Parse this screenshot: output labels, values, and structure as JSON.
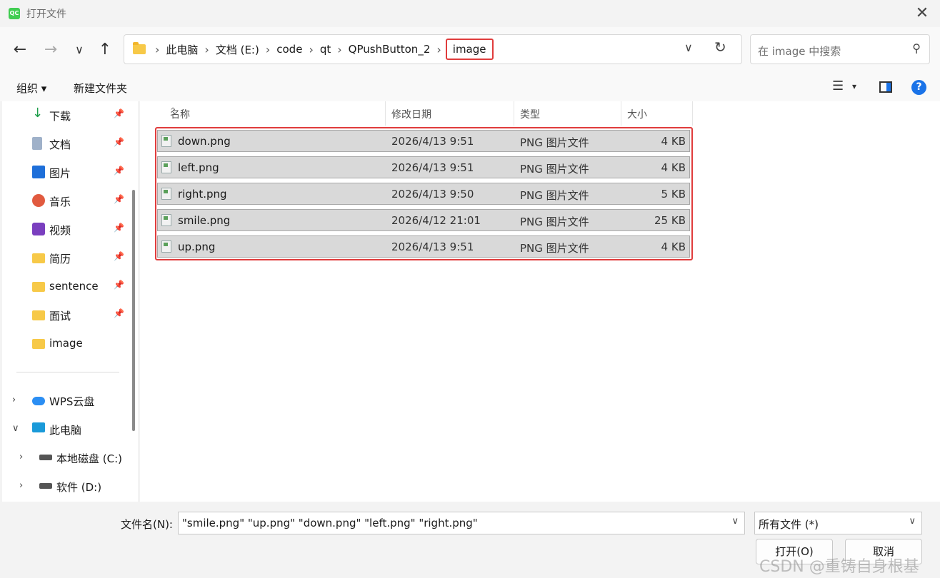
{
  "window": {
    "title": "打开文件",
    "app_icon": "QC"
  },
  "nav": {
    "back_icon": "←",
    "forward_icon": "→",
    "recent_icon": "∨",
    "up_icon": "↑",
    "breadcrumbs": [
      "此电脑",
      "文档 (E:)",
      "code",
      "qt",
      "QPushButton_2",
      "image"
    ],
    "separator": "›",
    "dropdown_icon": "∨",
    "refresh_icon": "↻",
    "search_placeholder": "在 image 中搜索",
    "search_icon": "⚲"
  },
  "toolbar": {
    "organize": "组织 ▾",
    "new_folder": "新建文件夹",
    "view_icon": "☰",
    "view_dd": "▾",
    "help": "?"
  },
  "sidebar": {
    "pin_icon": "📌",
    "items": [
      {
        "label": "下载",
        "icon": "download-icon",
        "pinned": true
      },
      {
        "label": "文档",
        "icon": "document-icon",
        "pinned": true
      },
      {
        "label": "图片",
        "icon": "pictures-icon",
        "pinned": true
      },
      {
        "label": "音乐",
        "icon": "music-icon",
        "pinned": true
      },
      {
        "label": "视频",
        "icon": "video-icon",
        "pinned": true
      },
      {
        "label": "简历",
        "icon": "folder-icon",
        "pinned": true
      },
      {
        "label": "sentence",
        "icon": "folder-icon",
        "pinned": true
      },
      {
        "label": "面试",
        "icon": "folder-icon",
        "pinned": true
      },
      {
        "label": "image",
        "icon": "folder-icon",
        "pinned": false
      }
    ],
    "tree": [
      {
        "label": "WPS云盘",
        "expander": "›",
        "icon": "cloud-icon"
      },
      {
        "label": "此电脑",
        "expander": "∨",
        "icon": "computer-icon"
      },
      {
        "label": "本地磁盘 (C:)",
        "expander": "›",
        "icon": "drive-icon"
      },
      {
        "label": "软件 (D:)",
        "expander": "›",
        "icon": "drive-icon"
      }
    ]
  },
  "files": {
    "columns": [
      "名称",
      "修改日期",
      "类型",
      "大小"
    ],
    "sort_caret": "^",
    "rows": [
      {
        "name": "down.png",
        "date": "2026/4/13 9:51",
        "type": "PNG 图片文件",
        "size": "4 KB"
      },
      {
        "name": "left.png",
        "date": "2026/4/13 9:51",
        "type": "PNG 图片文件",
        "size": "4 KB"
      },
      {
        "name": "right.png",
        "date": "2026/4/13 9:50",
        "type": "PNG 图片文件",
        "size": "5 KB"
      },
      {
        "name": "smile.png",
        "date": "2026/4/12 21:01",
        "type": "PNG 图片文件",
        "size": "25 KB"
      },
      {
        "name": "up.png",
        "date": "2026/4/13 9:51",
        "type": "PNG 图片文件",
        "size": "4 KB"
      }
    ]
  },
  "bottom": {
    "filename_label": "文件名(N):",
    "filename_value": "\"smile.png\" \"up.png\" \"down.png\" \"left.png\" \"right.png\"",
    "filetype_value": "所有文件 (*)",
    "dd_icon": "∨",
    "open_button": "打开(O)",
    "cancel_button": "取消",
    "watermark": "CSDN @重铸自身根基"
  }
}
